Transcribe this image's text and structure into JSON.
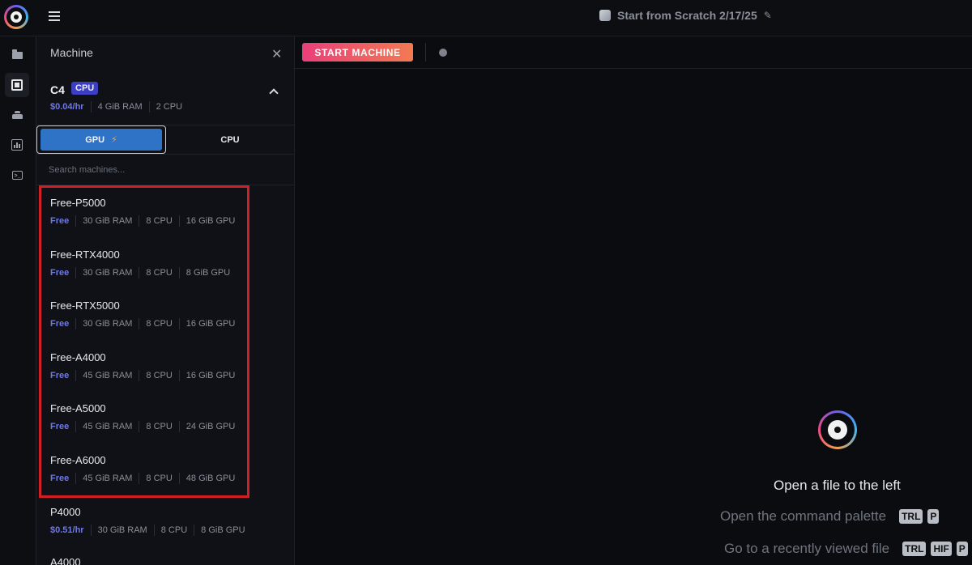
{
  "topbar": {
    "notebook_title": "Start from Scratch 2/17/25"
  },
  "panel": {
    "title": "Machine",
    "current": {
      "name": "C4",
      "badge": "CPU",
      "price": "$0.04/hr",
      "ram": "4 GiB RAM",
      "cpu": "2 CPU"
    },
    "tabs": {
      "gpu_label": "GPU",
      "cpu_label": "CPU"
    },
    "search_placeholder": "Search machines...",
    "machines": [
      {
        "name": "Free-P5000",
        "price": "Free",
        "ram": "30 GiB RAM",
        "cpu": "8 CPU",
        "gpu": "16 GiB GPU"
      },
      {
        "name": "Free-RTX4000",
        "price": "Free",
        "ram": "30 GiB RAM",
        "cpu": "8 CPU",
        "gpu": "8 GiB GPU"
      },
      {
        "name": "Free-RTX5000",
        "price": "Free",
        "ram": "30 GiB RAM",
        "cpu": "8 CPU",
        "gpu": "16 GiB GPU"
      },
      {
        "name": "Free-A4000",
        "price": "Free",
        "ram": "45 GiB RAM",
        "cpu": "8 CPU",
        "gpu": "16 GiB GPU"
      },
      {
        "name": "Free-A5000",
        "price": "Free",
        "ram": "45 GiB RAM",
        "cpu": "8 CPU",
        "gpu": "24 GiB GPU"
      },
      {
        "name": "Free-A6000",
        "price": "Free",
        "ram": "45 GiB RAM",
        "cpu": "8 CPU",
        "gpu": "48 GiB GPU"
      },
      {
        "name": "P4000",
        "price": "$0.51/hr",
        "ram": "30 GiB RAM",
        "cpu": "8 CPU",
        "gpu": "8 GiB GPU"
      },
      {
        "name": "A4000"
      }
    ]
  },
  "toolbar": {
    "start_label": "START MACHINE"
  },
  "empty_state": {
    "open_file": "Open a file to the left",
    "command_palette": "Open the command palette",
    "command_palette_keys": [
      "TRL",
      "P"
    ],
    "recent_file": "Go to a recently viewed file",
    "recent_file_keys": [
      "TRL",
      "HIF",
      "P"
    ]
  },
  "colors": {
    "accent_blue": "#2e73c5",
    "price_purple": "#6e79e6",
    "start_gradient_from": "#ea3f7a",
    "start_gradient_to": "#f27a52",
    "highlight_red": "#d21f25"
  }
}
